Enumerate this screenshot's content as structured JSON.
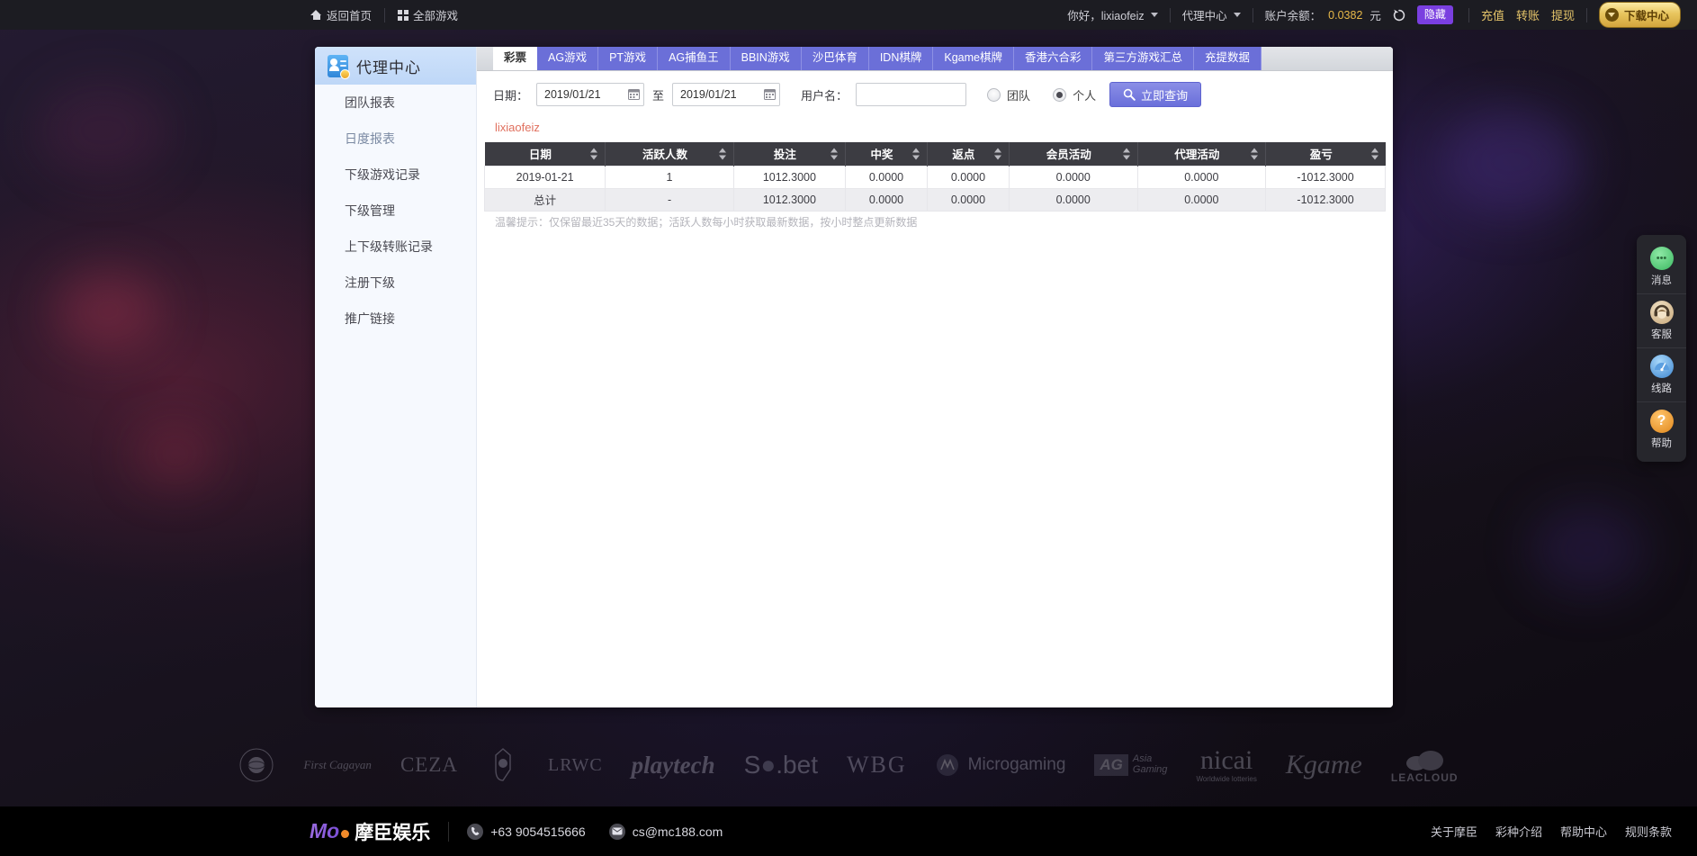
{
  "topbar": {
    "home_label": "返回首页",
    "all_games_label": "全部游戏",
    "greeting": "你好，lixiaofeiz",
    "agent_center_label": "代理中心",
    "balance_label": "账户余额：",
    "balance_amount": "0.0382",
    "balance_unit": "元",
    "hide_label": "隐藏",
    "deposit_label": "充值",
    "transfer_label": "转账",
    "withdraw_label": "提现",
    "download_label": "下载中心"
  },
  "sidebar": {
    "title": "代理中心",
    "items": [
      {
        "label": "团队报表",
        "active": false
      },
      {
        "label": "日度报表",
        "active": true
      },
      {
        "label": "下级游戏记录",
        "active": false
      },
      {
        "label": "下级管理",
        "active": false
      },
      {
        "label": "上下级转账记录",
        "active": false
      },
      {
        "label": "注册下级",
        "active": false
      },
      {
        "label": "推广链接",
        "active": false
      }
    ]
  },
  "tabs": [
    {
      "label": "彩票",
      "active": true
    },
    {
      "label": "AG游戏",
      "active": false
    },
    {
      "label": "PT游戏",
      "active": false
    },
    {
      "label": "AG捕鱼王",
      "active": false
    },
    {
      "label": "BBIN游戏",
      "active": false
    },
    {
      "label": "沙巴体育",
      "active": false
    },
    {
      "label": "IDN棋牌",
      "active": false
    },
    {
      "label": "Kgame棋牌",
      "active": false
    },
    {
      "label": "香港六合彩",
      "active": false
    },
    {
      "label": "第三方游戏汇总",
      "active": false
    },
    {
      "label": "充提数据",
      "active": false
    }
  ],
  "filter": {
    "date_label": "日期：",
    "date_from": "2019/01/21",
    "date_to": "2019/01/21",
    "to_label": "至",
    "username_label": "用户名：",
    "username_value": "",
    "username_placeholder": "",
    "radio_team_label": "团队",
    "radio_personal_label": "个人",
    "query_button_label": "立即查询"
  },
  "report": {
    "account_name": "lixiaofeiz",
    "columns": [
      "日期",
      "活跃人数",
      "投注",
      "中奖",
      "返点",
      "会员活动",
      "代理活动",
      "盈亏"
    ],
    "rows": [
      [
        "2019-01-21",
        "1",
        "1012.3000",
        "0.0000",
        "0.0000",
        "0.0000",
        "0.0000",
        "-1012.3000"
      ],
      [
        "总计",
        "-",
        "1012.3000",
        "0.0000",
        "0.0000",
        "0.0000",
        "0.0000",
        "-1012.3000"
      ]
    ],
    "tip": "温馨提示：仅保留最近35天的数据；活跃人数每小时获取最新数据，按小时整点更新数据"
  },
  "float_panel": [
    {
      "label": "消息",
      "icon": "message-icon"
    },
    {
      "label": "客服",
      "icon": "customer-service-icon"
    },
    {
      "label": "线路",
      "icon": "route-icon"
    },
    {
      "label": "帮助",
      "icon": "help-icon"
    }
  ],
  "partners": [
    "GLOBE",
    "First Cagayan",
    "CEZA",
    "CREST",
    "LRWC",
    "playtech",
    "SA.bet",
    "WBG",
    "Microgaming",
    "AG Asia Gaming",
    "nicai",
    "Kgame",
    "LEACLOUD"
  ],
  "footer": {
    "brand_mo": "Mo",
    "brand_cn": "摩臣娱乐",
    "phone": "+63 9054515666",
    "email": "cs@mc188.com",
    "links": [
      "关于摩臣",
      "彩种介绍",
      "帮助中心",
      "规则条款"
    ]
  },
  "colors": {
    "tab_active_bg": "#ffffff",
    "tab_bg": "#6b6fd8",
    "accent_purple": "#7a3fe0",
    "gold": "#e8b949",
    "table_header": "#3c3c42",
    "account_red": "#e0705e"
  }
}
